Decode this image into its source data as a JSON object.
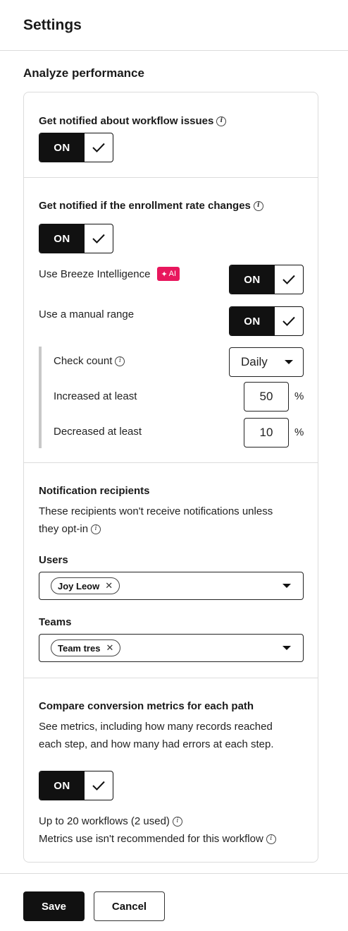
{
  "header": {
    "title": "Settings"
  },
  "section": {
    "title": "Analyze performance"
  },
  "workflow_issues": {
    "label": "Get notified about workflow issues",
    "toggle_label": "ON"
  },
  "enrollment": {
    "label": "Get notified if the enrollment rate changes",
    "toggle_label": "ON",
    "breeze": {
      "label": "Use Breeze Intelligence",
      "badge": "AI",
      "toggle_label": "ON"
    },
    "manual_range": {
      "label": "Use a manual range",
      "toggle_label": "ON"
    },
    "check_count": {
      "label": "Check count",
      "value": "Daily"
    },
    "increased": {
      "label": "Increased at least",
      "value": "50",
      "unit": "%"
    },
    "decreased": {
      "label": "Decreased at least",
      "value": "10",
      "unit": "%"
    }
  },
  "recipients": {
    "title": "Notification recipients",
    "description_line1": "These recipients won't receive notifications unless",
    "description_line2": "they opt-in",
    "users": {
      "label": "Users",
      "chip": "Joy Leow"
    },
    "teams": {
      "label": "Teams",
      "chip": "Team tres"
    }
  },
  "conversion": {
    "title": "Compare conversion metrics for each path",
    "description_line1": "See metrics, including how many records reached",
    "description_line2": "each step, and how many had errors at each step.",
    "toggle_label": "ON",
    "usage": "Up to 20 workflows (2 used)",
    "warning": "Metrics use isn't recommended for this workflow"
  },
  "footer": {
    "save_label": "Save",
    "cancel_label": "Cancel"
  },
  "colors": {
    "accent": "#111111",
    "ai_badge": "#e8175d",
    "border": "#dcdcdc"
  }
}
